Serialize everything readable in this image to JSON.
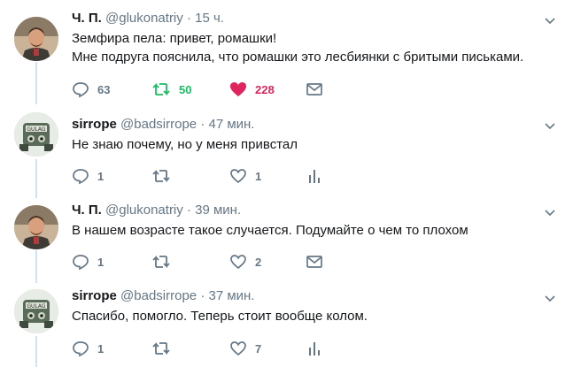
{
  "colors": {
    "retweet_active": "#17bf63",
    "like_active": "#e0245e",
    "muted": "#657786",
    "thread_line": "#cce4f7"
  },
  "tweets": [
    {
      "name": "Ч. П.",
      "handle": "@glukonatriy",
      "sep": "·",
      "time": "15 ч.",
      "lines": [
        "Земфира пела: привет, ромашки!",
        "Мне подруга пояснила, что ромашки это лесбиянки с бритыми письками."
      ],
      "replies": "63",
      "retweets": "50",
      "likes": "228",
      "retweeted": true,
      "liked": true,
      "last_icon": "envelope-icon",
      "avatar": "man-portrait-avatar"
    },
    {
      "name": "sirrope",
      "handle": "@badsirrope",
      "sep": "·",
      "time": "47 мин.",
      "lines": [
        "Не знаю почему, но у меня привстал"
      ],
      "replies": "1",
      "retweets": "",
      "likes": "1",
      "retweeted": false,
      "liked": false,
      "last_icon": "analytics-icon",
      "avatar": "gulag-cartoon-avatar"
    },
    {
      "name": "Ч. П.",
      "handle": "@glukonatriy",
      "sep": "·",
      "time": "39 мин.",
      "lines": [
        "В нашем возрасте такое случается. Подумайте о чем то плохом"
      ],
      "replies": "1",
      "retweets": "",
      "likes": "2",
      "retweeted": false,
      "liked": false,
      "last_icon": "envelope-icon",
      "avatar": "man-portrait-avatar"
    },
    {
      "name": "sirrope",
      "handle": "@badsirrope",
      "sep": "·",
      "time": "37 мин.",
      "lines": [
        "Спасибо, помогло. Теперь стоит вообще колом."
      ],
      "replies": "1",
      "retweets": "",
      "likes": "7",
      "retweeted": false,
      "liked": false,
      "last_icon": "analytics-icon",
      "avatar": "gulag-cartoon-avatar"
    }
  ]
}
